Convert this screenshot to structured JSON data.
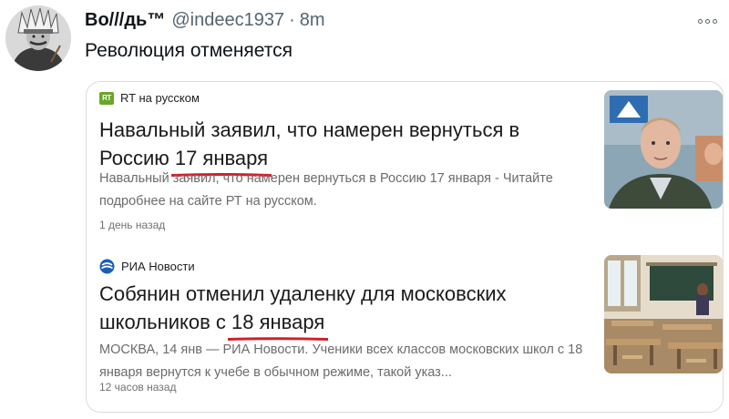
{
  "tweet": {
    "author_name": "Во///дь™",
    "author_handle": "@indeec1937",
    "separator": "·",
    "time": "8m",
    "text": "Революция отменяется"
  },
  "results": [
    {
      "source_icon": "rt-logo-icon",
      "source_icon_text": "RT",
      "source": "RT на русском",
      "headline_before": "Навальный заявил, что намерен вернуться в Россию ",
      "headline_date": "17 января",
      "headline_after": "",
      "snippet": "Навальный заявил, что намерен вернуться в Россию 17 января - Читайте подробнее на сайте РТ на русском.",
      "ago": "1 день назад",
      "thumbnail": "portrait-photo"
    },
    {
      "source_icon": "ria-logo-icon",
      "source": "РИА Новости",
      "headline_before": "Собянин отменил удаленку для московских школьников с ",
      "headline_date": "18 января",
      "headline_after": "",
      "snippet": "МОСКВА, 14 янв — РИА Новости. Ученики всех классов московских школ с 18 января вернутся к учебе в обычном режиме, такой указ...",
      "ago": "12 часов назад",
      "thumbnail": "classroom-photo"
    }
  ],
  "colors": {
    "underline": "#d0202a",
    "rt_green": "#6aa629",
    "ria_blue": "#1b5fb3",
    "text_secondary": "#536471"
  }
}
